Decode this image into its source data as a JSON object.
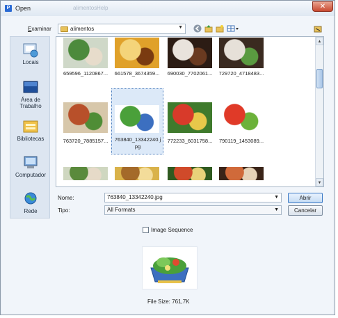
{
  "window": {
    "icon_letter": "P",
    "title": "Open",
    "bg_title_1": "alimentos",
    "bg_title_2": "Help",
    "close_glyph": "✕"
  },
  "toolbar": {
    "lookin_label": "Examinar",
    "lookin_value": "alimentos",
    "back_icon": "back-icon",
    "up_icon": "up-folder-icon",
    "new_folder_icon": "new-folder-icon",
    "views_icon": "views-menu-icon",
    "right_icon": "folder-icon"
  },
  "places": [
    {
      "label": "Locais",
      "icon": "recent-places-icon"
    },
    {
      "label": "Área de Trabalho",
      "icon": "desktop-icon"
    },
    {
      "label": "Bibliotecas",
      "icon": "libraries-icon"
    },
    {
      "label": "Computador",
      "icon": "computer-icon"
    },
    {
      "label": "Rede",
      "icon": "network-icon"
    }
  ],
  "files": [
    {
      "name": "659596_1120867...",
      "colors": [
        "#cfd8c8",
        "#4c8a3c",
        "#e7dccb"
      ]
    },
    {
      "name": "661578_3674359...",
      "colors": [
        "#e0a12a",
        "#f4d47a",
        "#7a3b10"
      ]
    },
    {
      "name": "690030_7702061...",
      "colors": [
        "#2c1c14",
        "#e9e3dc",
        "#6a3a20"
      ]
    },
    {
      "name": "729720_4718483...",
      "colors": [
        "#3a2a20",
        "#e6e0d8",
        "#5a9a40"
      ]
    },
    {
      "name": "763720_7885157...",
      "colors": [
        "#d7c7aa",
        "#b8502a",
        "#4f8d36"
      ]
    },
    {
      "name": "763840_13342240.jpg",
      "colors": [
        "#ffffff",
        "#4aa03a",
        "#3c6fc0"
      ],
      "selected": true
    },
    {
      "name": "772233_6031758...",
      "colors": [
        "#3f7a2c",
        "#d83a2a",
        "#e8c84a"
      ]
    },
    {
      "name": "790119_1453089...",
      "colors": [
        "#ffffff",
        "#e03a28",
        "#6cb23a"
      ]
    },
    {
      "name": "",
      "colors": [
        "#cfd7c0",
        "#5a8a3c",
        "#e6dac8"
      ]
    },
    {
      "name": "",
      "colors": [
        "#d9b24a",
        "#a46a2a",
        "#f3dc9a"
      ]
    },
    {
      "name": "",
      "colors": [
        "#2f5a20",
        "#d04a2a",
        "#e8d27a"
      ]
    },
    {
      "name": "",
      "colors": [
        "#3a2418",
        "#d06a3a",
        "#e6d3b8"
      ]
    }
  ],
  "filename": {
    "label": "Nome:",
    "value": "763840_13342240.jpg"
  },
  "filetype": {
    "label": "Tipo:",
    "value": "All Formats"
  },
  "buttons": {
    "open": "Abrir",
    "cancel": "Cancelar"
  },
  "image_sequence": {
    "label": "Image Sequence",
    "checked": false
  },
  "preview": {
    "colors": [
      "#ffffff",
      "#4aa03a",
      "#3c6fc0"
    ]
  },
  "file_size": {
    "label": "File Size:",
    "value": "761,7K"
  },
  "scrollbar": {
    "up": "▲",
    "down": "▼"
  },
  "colors": {
    "selection": "#dce9f8",
    "window_bg": "#eef3f9",
    "places_bg": "#dde6f1",
    "accent": "#3b79c5"
  }
}
